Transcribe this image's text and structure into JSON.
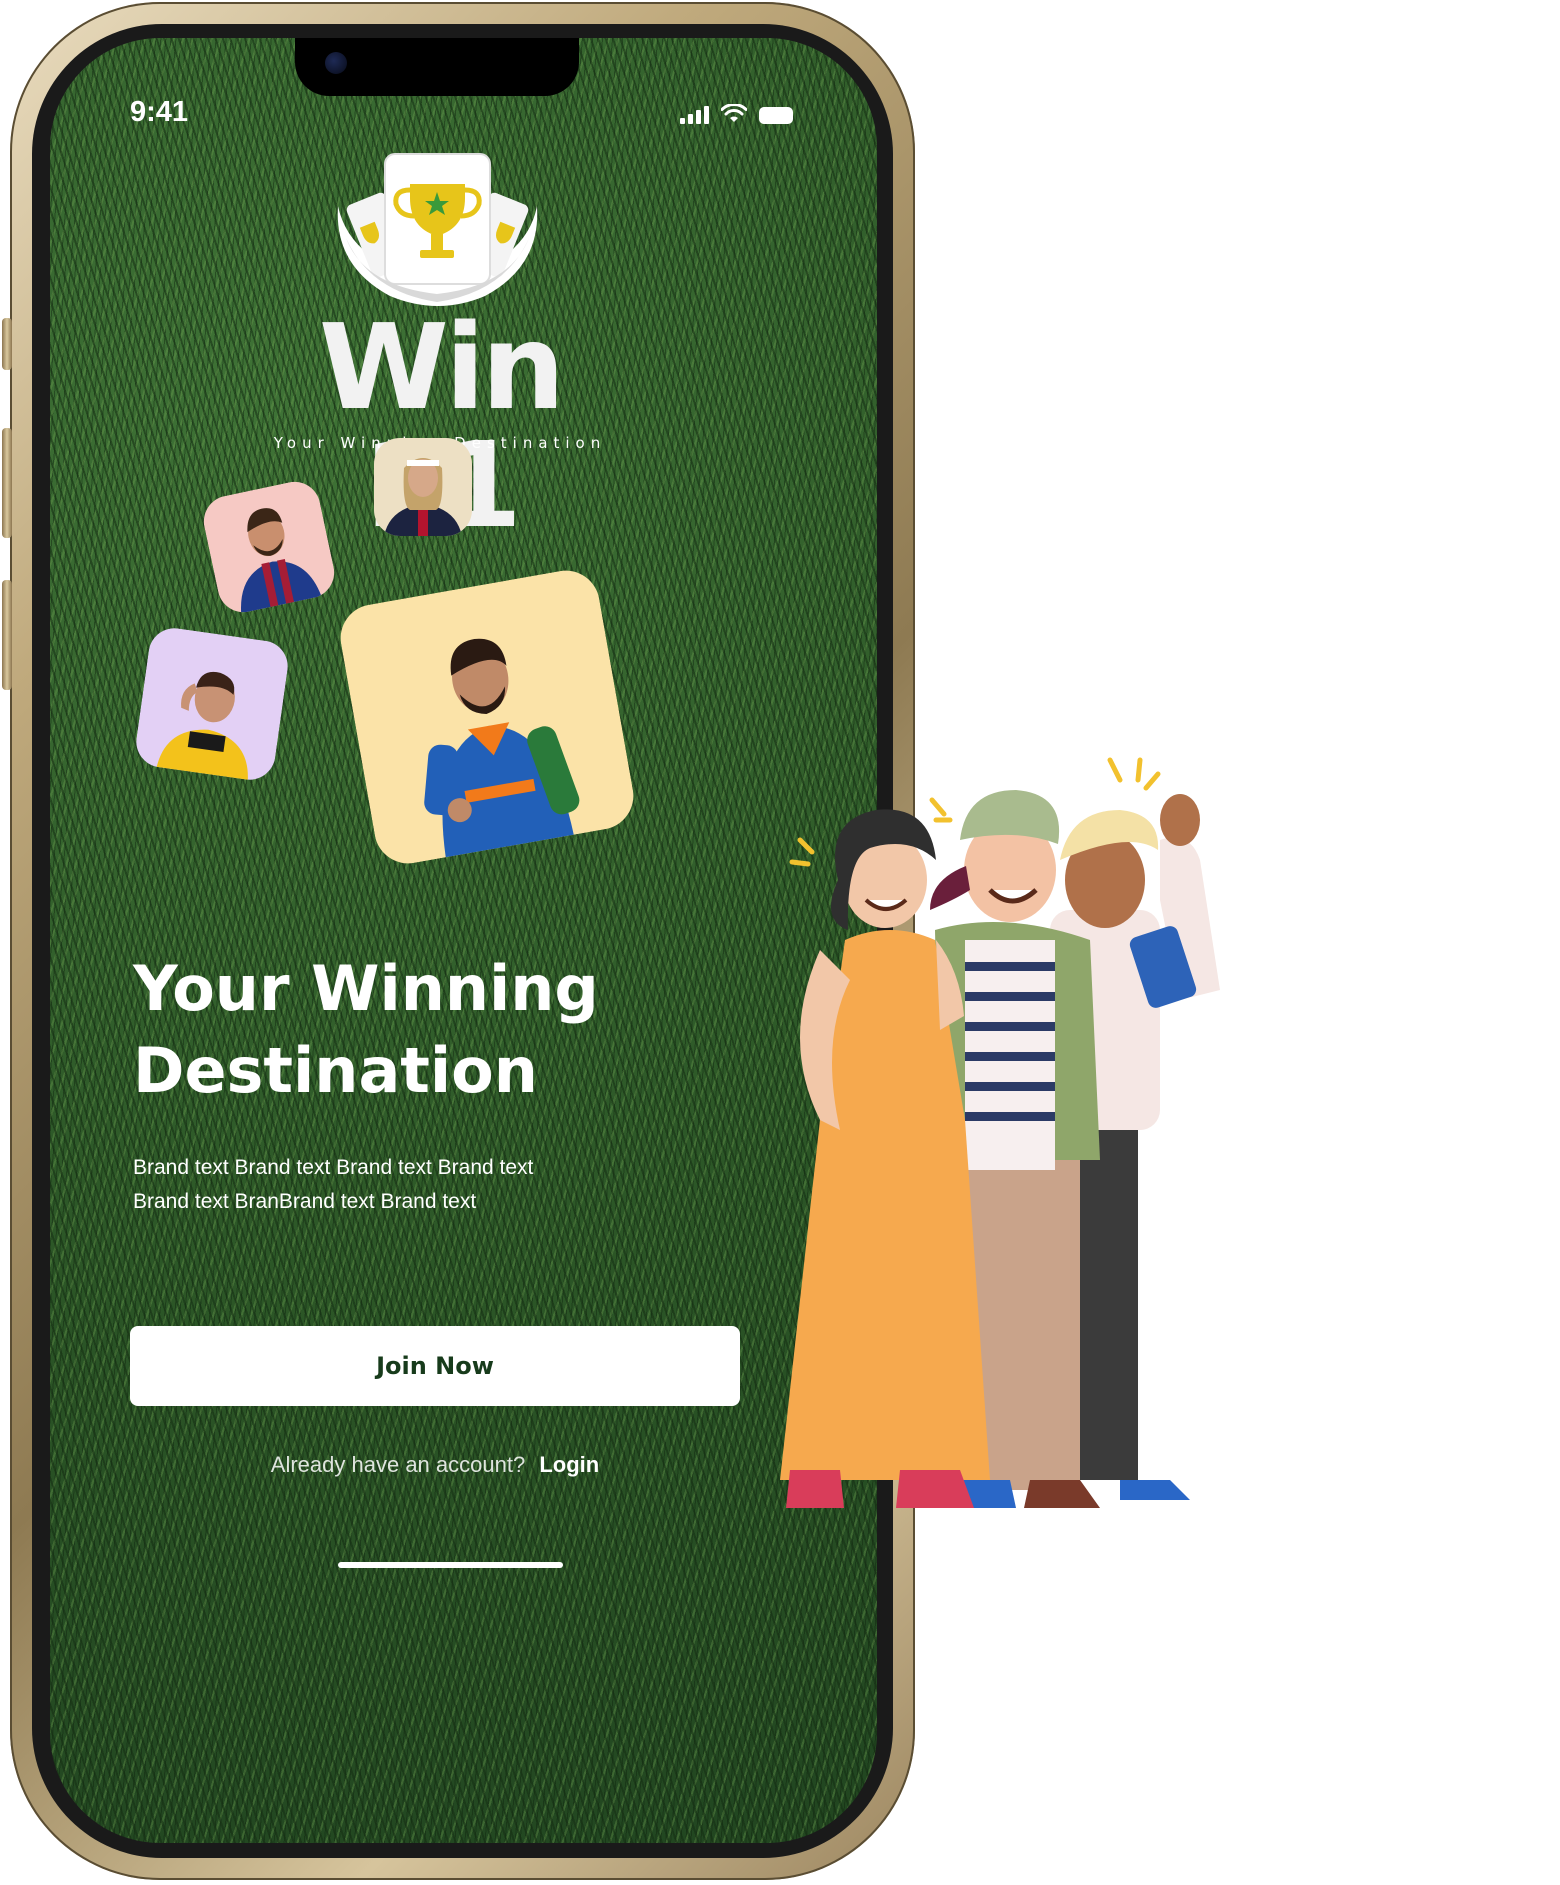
{
  "status_bar": {
    "time": "9:41",
    "icons": [
      "cellular-signal-icon",
      "wifi-icon",
      "battery-icon"
    ]
  },
  "brand": {
    "name": "Win 11",
    "tagline": "Your Winning Destination",
    "logo_icon": "trophy-icon"
  },
  "player_cards": [
    {
      "name": "player-card-footballer",
      "bg": "#f6c9c4",
      "jersey": "#1f3b8c"
    },
    {
      "name": "player-card-handball",
      "bg": "#ede0c4",
      "jersey": "#1c2340"
    },
    {
      "name": "player-card-volleyball",
      "bg": "#e3d0f5",
      "jersey": "#f3c21b"
    },
    {
      "name": "player-card-cricketer",
      "bg": "#fbe3a8",
      "jersey": "#2260b8"
    }
  ],
  "hero": {
    "headline_line1": "Your Winning",
    "headline_line2": "Destination",
    "body_line1": "Brand text Brand text Brand text Brand text",
    "body_line2": "Brand text BranBrand text  Brand text"
  },
  "actions": {
    "join_label": "Join Now",
    "login_prompt": "Already have an account?",
    "login_label": "Login"
  },
  "colors": {
    "grass": "#2f5a2a",
    "button_text": "#173b1b",
    "trophy": "#e7c51a",
    "frame_gold": "#bfa97c"
  },
  "illustration": {
    "icon": "friends-selfie-illustration"
  }
}
